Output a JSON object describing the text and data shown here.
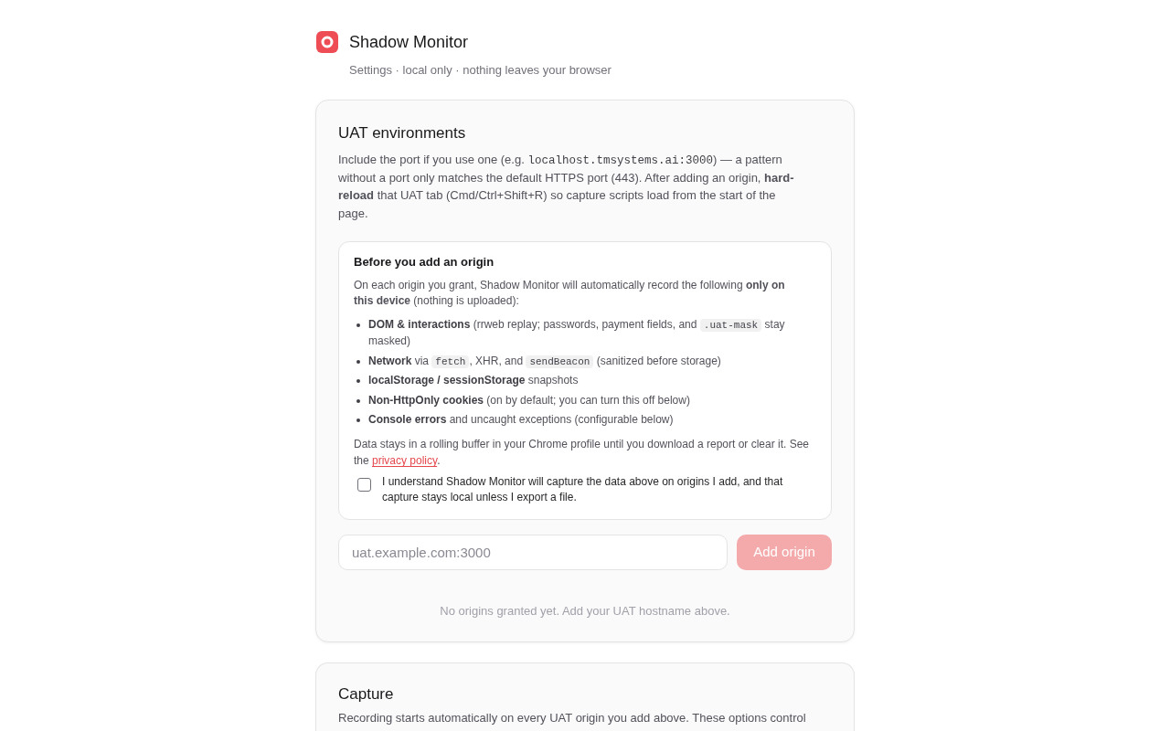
{
  "header": {
    "title": "Shadow Monitor",
    "subtitle": "Settings · local only · nothing leaves your browser"
  },
  "uat_environments": {
    "title": "UAT environments",
    "description": [
      {
        "kind": "text",
        "text": "Include the port if you use one (e.g. "
      },
      {
        "kind": "code",
        "text": "localhost.tmsystems.ai:3000"
      },
      {
        "kind": "text",
        "text": ") — a pattern without a port only matches the default HTTPS port (443). After adding an origin, **hard-reload** that UAT tab (Cmd/Ctrl+Shift+R) so capture scripts load from the start of the page."
      }
    ],
    "notice": {
      "title": "Before you add an origin",
      "intro": "On each origin you grant, Shadow Monitor will automatically record the following **only on this device** (nothing is uploaded):",
      "items": [
        {
          "segments": [
            {
              "kind": "text",
              "text": "**DOM & interactions** (rrweb replay; passwords, payment fields, and "
            },
            {
              "kind": "code",
              "text": ".uat-mask"
            },
            {
              "kind": "text",
              "text": " stay masked)"
            }
          ]
        },
        {
          "segments": [
            {
              "kind": "text",
              "text": "**Network** via "
            },
            {
              "kind": "code",
              "text": "fetch"
            },
            {
              "kind": "text",
              "text": ", XHR, and "
            },
            {
              "kind": "code",
              "text": "sendBeacon"
            },
            {
              "kind": "text",
              "text": " (sanitized before storage)"
            }
          ]
        },
        {
          "segments": [
            {
              "kind": "text",
              "text": "**localStorage / sessionStorage** snapshots"
            }
          ]
        },
        {
          "segments": [
            {
              "kind": "text",
              "text": "**Non-HttpOnly cookies** (on by default; you can turn this off below)"
            }
          ]
        },
        {
          "segments": [
            {
              "kind": "text",
              "text": "**Console errors** and uncaught exceptions (configurable below)"
            }
          ]
        }
      ],
      "note": [
        {
          "kind": "text",
          "text": "Data stays in a rolling buffer in your Chrome profile until you download a report or clear it. See the "
        },
        {
          "kind": "link",
          "text": "privacy policy"
        },
        {
          "kind": "text",
          "text": "."
        }
      ],
      "consent": {
        "label": "I understand Shadow Monitor will capture the data above on origins I add, and that capture stays local unless I export a file.",
        "checked": false
      }
    },
    "origin_input": {
      "placeholder": "uat.example.com:3000"
    },
    "add_button": {
      "label": "Add origin",
      "disabled": true
    },
    "empty_message": "No origins granted yet. Add your UAT hostname above."
  },
  "capture": {
    "title": "Capture",
    "description": "Recording starts automatically on every UAT origin you add above. These options control"
  }
}
